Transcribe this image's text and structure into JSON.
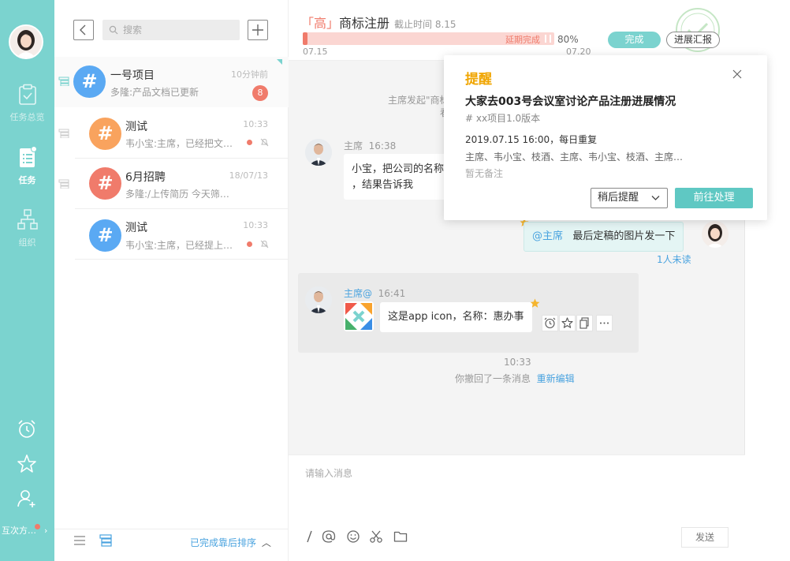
{
  "sidebar": {
    "nav": [
      {
        "label": "任务总览",
        "icon": "clipboard-check-icon"
      },
      {
        "label": "任务",
        "icon": "document-list-icon"
      },
      {
        "label": "组织",
        "icon": "org-chart-icon"
      }
    ],
    "bottom_icons": [
      "alarm-clock-icon",
      "star-icon",
      "add-user-icon"
    ],
    "footer_label": "互次方…",
    "accent": "#7bd3cf"
  },
  "list": {
    "search_placeholder": "搜索",
    "items": [
      {
        "name": "一号项目",
        "time": "10分钟前",
        "sub": "多隆:产品文档已更新",
        "badge": "8",
        "avatar_color": "#5aa9f3",
        "avatar_glyph": "#"
      },
      {
        "name": "测试",
        "time": "10:33",
        "sub": "韦小宝:主席，已经把文…",
        "avatar_color": "#f9a35e",
        "avatar_glyph": "#"
      },
      {
        "name": "6月招聘",
        "time": "18/07/13",
        "sub": "多隆:/上传简历 今天筛…",
        "avatar_color": "#f07b6b",
        "avatar_glyph": "#"
      },
      {
        "name": "测试",
        "time": "10:33",
        "sub": "韦小宝:主席，已经提上…",
        "avatar_color": "#5aa9f3",
        "avatar_glyph": "#"
      }
    ],
    "sort_label": "已完成靠后排序"
  },
  "chat": {
    "priority": "「高」",
    "title": "商标注册",
    "deadline": "截止时间 8.15",
    "progress_label": "延期完成",
    "progress_percent": "80%",
    "start_date": "07.15",
    "end_date": "07.20",
    "done_button": "完成",
    "report_button": "进展汇报",
    "sys_line1": "主席发起\"商标",
    "sys_line2": "看",
    "msg1": {
      "name": "主席",
      "time": "16:38",
      "text": "小宝，把公司的名称",
      "text2": "，结果告诉我"
    },
    "msg_me": {
      "mention": "@主席",
      "text": "最后定稿的图片发一下",
      "unread": "1人未读"
    },
    "msg2": {
      "name": "主席@",
      "time": "16:41",
      "text": "这是app icon，名称：惠办事"
    },
    "time_divider": "10:33",
    "recall_text": "你撤回了一条消息",
    "reedit": "重新编辑",
    "input_placeholder": "请输入消息",
    "send": "发送",
    "composer_tools": [
      "slash-command-icon",
      "at-mention-icon",
      "emoji-icon",
      "scissors-icon",
      "folder-icon"
    ]
  },
  "popup": {
    "title": "提醒",
    "heading": "大家去003号会议室讨论产品注册进展情况",
    "tag": "# xx项目1.0版本",
    "time": "2019.07.15 16:00，每日重复",
    "people": "主席、韦小宝、枝酒、主席、韦小宝、枝酒、主席…",
    "note": "暂无备注",
    "later": "稍后提醒",
    "go": "前往处理"
  }
}
